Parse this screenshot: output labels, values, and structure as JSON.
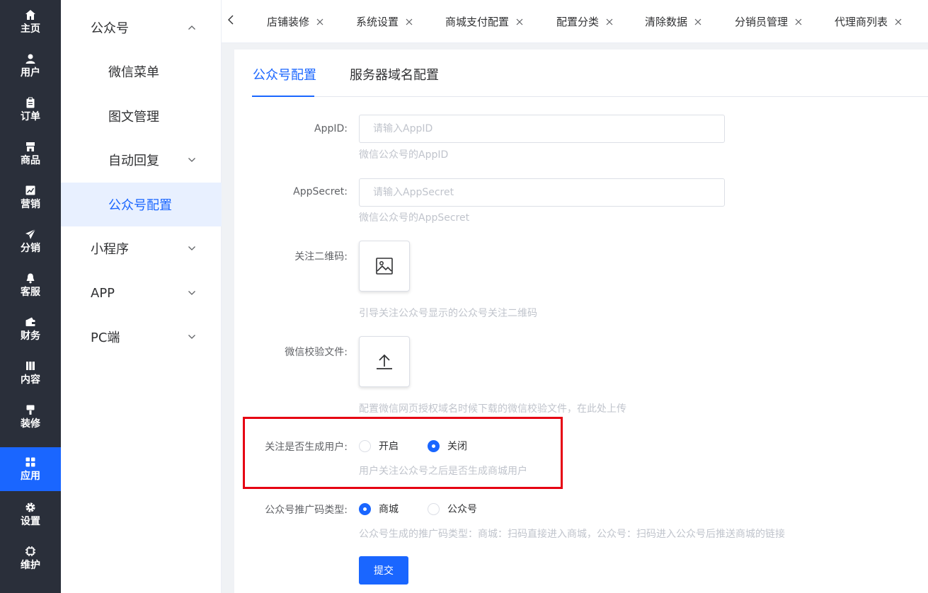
{
  "rail": {
    "items": [
      {
        "label": "主页",
        "icon": "home-icon"
      },
      {
        "label": "用户",
        "icon": "user-icon"
      },
      {
        "label": "订单",
        "icon": "clipboard-icon"
      },
      {
        "label": "商品",
        "icon": "store-icon"
      },
      {
        "label": "营销",
        "icon": "chart-icon"
      },
      {
        "label": "分销",
        "icon": "send-icon"
      },
      {
        "label": "客服",
        "icon": "bell-icon"
      },
      {
        "label": "财务",
        "icon": "wallet-icon"
      },
      {
        "label": "内容",
        "icon": "book-icon"
      },
      {
        "label": "装修",
        "icon": "brush-icon"
      },
      {
        "label": "应用",
        "icon": "apps-icon"
      },
      {
        "label": "设置",
        "icon": "gear-icon"
      },
      {
        "label": "维护",
        "icon": "chip-icon"
      }
    ],
    "active_index": 10,
    "accent_color": "#1a66ff"
  },
  "submenu": {
    "items": [
      {
        "label": "公众号",
        "level": 1,
        "arrow": "up"
      },
      {
        "label": "微信菜单",
        "level": 2
      },
      {
        "label": "图文管理",
        "level": 2
      },
      {
        "label": "自动回复",
        "level": 2,
        "arrow": "down"
      },
      {
        "label": "公众号配置",
        "level": 2,
        "active": true
      },
      {
        "label": "小程序",
        "level": 1,
        "arrow": "down"
      },
      {
        "label": "APP",
        "level": 1,
        "arrow": "down"
      },
      {
        "label": "PC端",
        "level": 1,
        "arrow": "down"
      }
    ]
  },
  "tabs": {
    "items": [
      "店铺装修",
      "系统设置",
      "商城支付配置",
      "配置分类",
      "清除数据",
      "分销员管理",
      "代理商列表"
    ]
  },
  "content_tabs": {
    "items": [
      "公众号配置",
      "服务器域名配置"
    ],
    "active_index": 0
  },
  "form": {
    "appid": {
      "label": "AppID:",
      "placeholder": "请输入AppID",
      "hint": "微信公众号的AppID"
    },
    "appsecret": {
      "label": "AppSecret:",
      "placeholder": "请输入AppSecret",
      "hint": "微信公众号的AppSecret"
    },
    "qrcode": {
      "label": "关注二维码:",
      "hint": "引导关注公众号显示的公众号关注二维码"
    },
    "verify_file": {
      "label": "微信校验文件:",
      "hint": "配置微信网页授权域名时候下载的微信校验文件，在此处上传"
    },
    "follow_user": {
      "label": "关注是否生成用户:",
      "options": [
        "开启",
        "关闭"
      ],
      "selected_index": 1,
      "hint": "用户关注公众号之后是否生成商城用户"
    },
    "promo_type": {
      "label": "公众号推广码类型:",
      "options": [
        "商城",
        "公众号"
      ],
      "selected_index": 0,
      "hint": "公众号生成的推广码类型：商城：扫码直接进入商城，公众号：扫码进入公众号后推送商城的链接"
    },
    "submit_label": "提交"
  },
  "highlight_color": "#e60012"
}
